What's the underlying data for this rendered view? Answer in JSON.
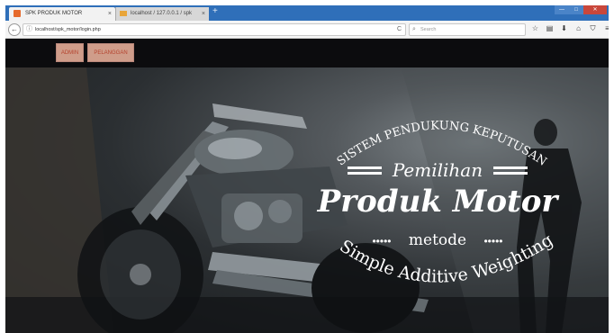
{
  "browser": {
    "tabs": [
      {
        "title": "SPK PRODUK MOTOR",
        "close": "×",
        "active": true
      },
      {
        "title": "localhost / 127.0.0.1 / spk",
        "close": "×",
        "active": false
      }
    ],
    "new_tab": "+",
    "window_buttons": {
      "minimize": "—",
      "maximize": "□",
      "close": "✕"
    },
    "back": "←",
    "info": "ⓘ",
    "url": "localhost/spk_motor/login.php",
    "reload": "C",
    "search_icon": "⌕",
    "search_placeholder": "Search",
    "toolbar_icons": [
      "star-icon",
      "library-icon",
      "download-icon",
      "home-icon",
      "pocket-icon",
      "menu-icon"
    ],
    "toolbar_glyphs": [
      "☆",
      "▤",
      "⬇",
      "⌂",
      "⛉",
      "≡"
    ]
  },
  "site": {
    "nav": {
      "admin": "ADMIN",
      "pelanggan": "PELANGGAN"
    },
    "hero": {
      "line1": "SISTEM PENDUKUNG KEPUTUSAN",
      "line2": "Pemilihan",
      "line3": "Produk Motor",
      "line4": "metode",
      "line5": "Simple Additive Weighting"
    }
  },
  "colors": {
    "titlebar": "#2f6fb9",
    "site_nav": "#0c0c0e",
    "nav_button": "#cf9d8a",
    "nav_button_text": "#b5432e",
    "hero_text": "#ffffff"
  }
}
